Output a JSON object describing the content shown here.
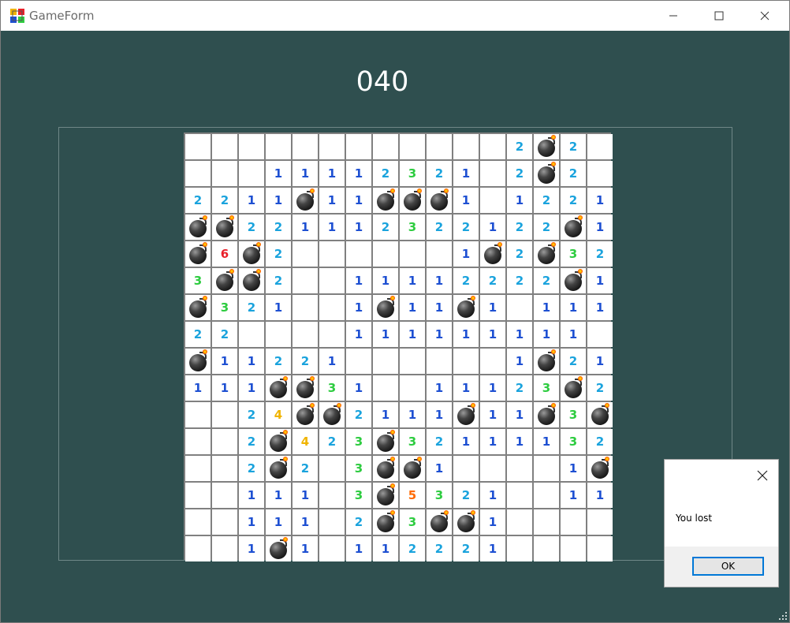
{
  "window": {
    "title": "GameForm",
    "icons": {
      "app": "app-icon",
      "minimize": "minimize-icon",
      "maximize": "maximize-icon",
      "close": "close-icon"
    }
  },
  "game": {
    "counter": "040",
    "board": {
      "rows": [
        [
          "",
          "",
          "",
          "",
          "",
          "",
          "",
          "",
          "",
          "",
          "",
          "",
          "2",
          "*",
          "2",
          ""
        ],
        [
          "",
          "",
          "",
          "1",
          "1",
          "1",
          "1",
          "2",
          "3",
          "2",
          "1",
          "",
          "2",
          "*",
          "2",
          ""
        ],
        [
          "2",
          "2",
          "1",
          "1",
          "*",
          "1",
          "1",
          "*",
          "*",
          "*",
          "1",
          "",
          "1",
          "2",
          "2",
          "1"
        ],
        [
          "*",
          "*",
          "2",
          "2",
          "1",
          "1",
          "1",
          "2",
          "3",
          "2",
          "2",
          "1",
          "2",
          "2",
          "*",
          "1"
        ],
        [
          "*",
          "6",
          "*",
          "2",
          "",
          "",
          "",
          "",
          "",
          "",
          "1",
          "*",
          "2",
          "*",
          "3",
          "2"
        ],
        [
          "3",
          "*",
          "*",
          "2",
          "",
          "",
          "1",
          "1",
          "1",
          "1",
          "2",
          "2",
          "2",
          "2",
          "*",
          "1"
        ],
        [
          "*",
          "3",
          "2",
          "1",
          "",
          "",
          "1",
          "*",
          "1",
          "1",
          "*",
          "1",
          "",
          "1",
          "1",
          "1"
        ],
        [
          "2",
          "2",
          "",
          "",
          "",
          "",
          "1",
          "1",
          "1",
          "1",
          "1",
          "1",
          "1",
          "1",
          "1",
          ""
        ],
        [
          "*",
          "1",
          "1",
          "2",
          "2",
          "1",
          "",
          "",
          "",
          "",
          "",
          "",
          "1",
          "*",
          "2",
          "1"
        ],
        [
          "1",
          "1",
          "1",
          "*",
          "*",
          "3",
          "1",
          "",
          "",
          "1",
          "1",
          "1",
          "2",
          "3",
          "*",
          "2"
        ],
        [
          "",
          "",
          "2",
          "4",
          "*",
          "*",
          "2",
          "1",
          "1",
          "1",
          "*",
          "1",
          "1",
          "*",
          "3",
          "*"
        ],
        [
          "",
          "",
          "2",
          "*",
          "4",
          "2",
          "3",
          "*",
          "3",
          "2",
          "1",
          "1",
          "1",
          "1",
          "3",
          "2"
        ],
        [
          "",
          "",
          "2",
          "*",
          "2",
          "",
          "3",
          "*",
          "*",
          "1",
          "",
          "",
          "",
          "",
          "1",
          "*"
        ],
        [
          "",
          "",
          "1",
          "1",
          "1",
          "",
          "3",
          "*",
          "5",
          "3",
          "2",
          "1",
          "",
          "",
          "1",
          "1"
        ],
        [
          "",
          "",
          "1",
          "1",
          "1",
          "",
          "2",
          "*",
          "3",
          "*",
          "*",
          "1",
          "",
          "",
          "",
          ""
        ],
        [
          "",
          "",
          "1",
          "*",
          "1",
          "",
          "1",
          "1",
          "2",
          "2",
          "2",
          "1",
          "",
          "",
          "",
          ""
        ]
      ]
    },
    "number_colors": {
      "1": "#1e50d2",
      "2": "#1aa3dd",
      "3": "#2ecc40",
      "4": "#f0b400",
      "5": "#ff6a00",
      "6": "#e8202a"
    },
    "mine_icon": "bomb-icon"
  },
  "dialog": {
    "message": "You lost",
    "ok_label": "OK",
    "close_icon": "close-icon"
  }
}
